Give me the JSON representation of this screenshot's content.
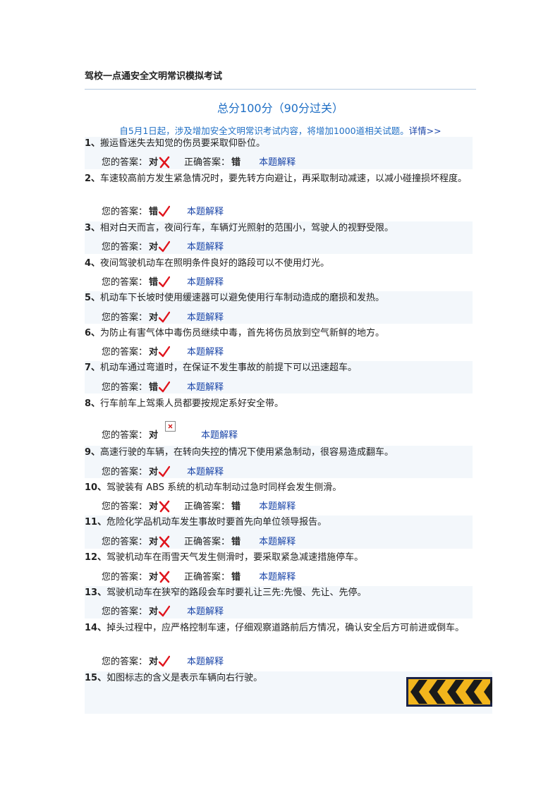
{
  "page": {
    "title": "驾校一点通安全文明常识模拟考试",
    "score_title": "总分100分（90分过关）",
    "notice": "自5月1日起，涉及增加安全文明常识考试内容，将增加1000道相关试题。",
    "notice_link": "详情>>"
  },
  "labels": {
    "your_answer": "您的答案：",
    "correct_answer": "正确答案：",
    "explain": "本题解释"
  },
  "questions": [
    {
      "num": "1、",
      "text": "搬运昏迷失去知觉的伤员要采取仰卧位。",
      "your": "对",
      "mark": "wrong",
      "correct": "错"
    },
    {
      "num": "2、",
      "text": "车速较高前方发生紧急情况时，要先转方向避让，再采取制动减速，以减小碰撞损坏程度。",
      "your": "错",
      "mark": "right"
    },
    {
      "num": "3、",
      "text": "相对白天而言，夜间行车，车辆灯光照射的范围小，驾驶人的视野受限。",
      "your": "对",
      "mark": "right"
    },
    {
      "num": "4、",
      "text": "夜间驾驶机动车在照明条件良好的路段可以不使用灯光。",
      "your": "错",
      "mark": "right"
    },
    {
      "num": "5、",
      "text": "机动车下长坡时使用缓速器可以避免使用行车制动造成的磨损和发热。",
      "your": "对",
      "mark": "right"
    },
    {
      "num": "6、",
      "text": "为防止有害气体中毒伤员继续中毒，首先将伤员放到空气新鲜的地方。",
      "your": "对",
      "mark": "right"
    },
    {
      "num": "7、",
      "text": "机动车通过弯道时，在保证不发生事故的前提下可以迅速超车。",
      "your": "错",
      "mark": "right"
    },
    {
      "num": "8、",
      "text": "行车前车上驾乘人员都要按规定系好安全带。",
      "your": "对",
      "mark": "broken"
    },
    {
      "num": "9、",
      "text": "高速行驶的车辆，在转向失控的情况下使用紧急制动，很容易造成翻车。",
      "your": "对",
      "mark": "right"
    },
    {
      "num": "10、",
      "text": "驾驶装有 ABS 系统的机动车制动过急时同样会发生侧滑。",
      "your": "对",
      "mark": "wrong",
      "correct": "错"
    },
    {
      "num": "11、",
      "text": "危险化学品机动车发生事故时要首先向单位领导报告。",
      "your": "对",
      "mark": "wrong",
      "correct": "错"
    },
    {
      "num": "12、",
      "text": "驾驶机动车在雨雪天气发生侧滑时，要采取紧急减速措施停车。",
      "your": "对",
      "mark": "wrong",
      "correct": "错"
    },
    {
      "num": "13、",
      "text": "驾驶机动车在狭窄的路段会车时要礼让三先:先慢、先让、先停。",
      "your": "对",
      "mark": "right"
    },
    {
      "num": "14、",
      "text": "掉头过程中，应严格控制车速，仔细观察道路前后方情况，确认安全后方可前进或倒车。",
      "your": "对",
      "mark": "right"
    },
    {
      "num": "15、",
      "text": "如图标志的含义是表示车辆向右行驶。"
    }
  ],
  "colors": {
    "accent": "#1f6fc5",
    "link": "#1a45a8",
    "mark": "#e0141c",
    "shade": "#f3f7fb"
  },
  "icons": {
    "right": "red-check-icon",
    "wrong": "red-cross-icon",
    "broken": "broken-image-icon",
    "sign": "chevron-sign"
  }
}
